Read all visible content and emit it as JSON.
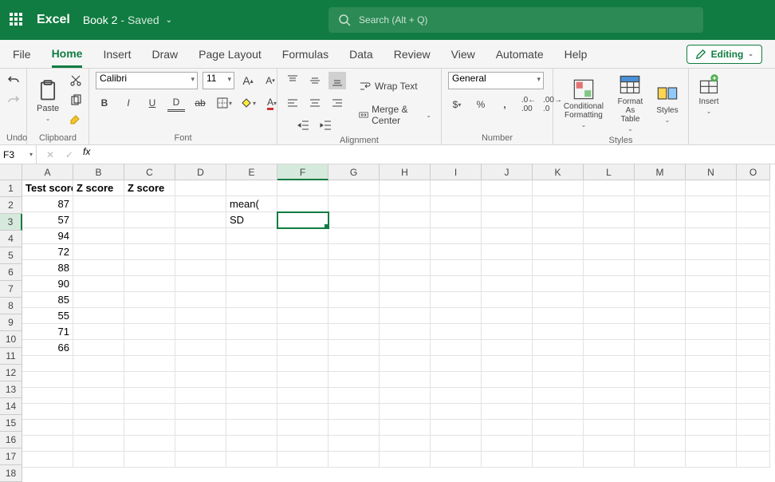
{
  "app": {
    "name": "Excel",
    "doc": "Book 2",
    "saved": "- Saved"
  },
  "search": {
    "placeholder": "Search (Alt + Q)"
  },
  "tabs": {
    "list": [
      "File",
      "Home",
      "Insert",
      "Draw",
      "Page Layout",
      "Formulas",
      "Data",
      "Review",
      "View",
      "Automate",
      "Help"
    ],
    "active": "Home",
    "editing": "Editing"
  },
  "ribbon": {
    "undo": {
      "label": "Undo"
    },
    "clipboard": {
      "label": "Clipboard",
      "paste": "Paste"
    },
    "font": {
      "label": "Font",
      "name": "Calibri",
      "size": "11"
    },
    "alignment": {
      "label": "Alignment",
      "wrap": "Wrap Text",
      "merge": "Merge & Center"
    },
    "number": {
      "label": "Number",
      "format": "General"
    },
    "styles": {
      "label": "Styles",
      "cond": "Conditional Formatting",
      "fmt": "Format As Table",
      "styles": "Styles"
    },
    "insert": {
      "label": "Insert"
    }
  },
  "fbar": {
    "name": "F3"
  },
  "grid": {
    "cols": [
      {
        "l": "A",
        "w": 64
      },
      {
        "l": "B",
        "w": 64
      },
      {
        "l": "C",
        "w": 64
      },
      {
        "l": "D",
        "w": 64
      },
      {
        "l": "E",
        "w": 64
      },
      {
        "l": "F",
        "w": 64
      },
      {
        "l": "G",
        "w": 64
      },
      {
        "l": "H",
        "w": 64
      },
      {
        "l": "I",
        "w": 64
      },
      {
        "l": "J",
        "w": 64
      },
      {
        "l": "K",
        "w": 64
      },
      {
        "l": "L",
        "w": 64
      },
      {
        "l": "M",
        "w": 64
      },
      {
        "l": "N",
        "w": 64
      },
      {
        "l": "O",
        "w": 42
      }
    ],
    "rows": 18,
    "sel": {
      "col": 5,
      "row": 2
    },
    "data": {
      "0": {
        "0": {
          "v": "Test score",
          "b": true
        },
        "1": {
          "v": "Z score",
          "b": true
        },
        "2": {
          "v": "Z score",
          "b": true
        }
      },
      "1": {
        "0": {
          "v": "87",
          "n": true
        },
        "4": {
          "v": "mean("
        }
      },
      "2": {
        "0": {
          "v": "57",
          "n": true
        },
        "4": {
          "v": "SD"
        }
      },
      "3": {
        "0": {
          "v": "94",
          "n": true
        }
      },
      "4": {
        "0": {
          "v": "72",
          "n": true
        }
      },
      "5": {
        "0": {
          "v": "88",
          "n": true
        }
      },
      "6": {
        "0": {
          "v": "90",
          "n": true
        }
      },
      "7": {
        "0": {
          "v": "85",
          "n": true
        }
      },
      "8": {
        "0": {
          "v": "55",
          "n": true
        }
      },
      "9": {
        "0": {
          "v": "71",
          "n": true
        }
      },
      "10": {
        "0": {
          "v": "66",
          "n": true
        }
      }
    }
  }
}
